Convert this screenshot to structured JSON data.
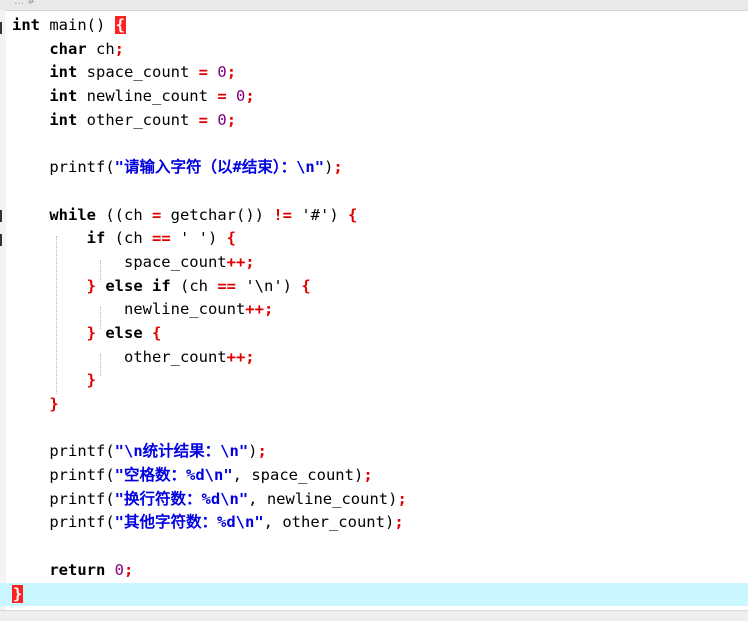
{
  "editor": {
    "tab_hint": "…  #",
    "lines": [
      {
        "segments": [
          {
            "t": "int",
            "c": "kw"
          },
          {
            "t": " main() ",
            "c": ""
          },
          {
            "t": "{",
            "c": "brace-hl"
          }
        ]
      },
      {
        "segments": [
          {
            "t": "    char",
            "c": "kw"
          },
          {
            "t": " ch",
            "c": ""
          },
          {
            "t": ";",
            "c": "op"
          }
        ]
      },
      {
        "segments": [
          {
            "t": "    int",
            "c": "kw"
          },
          {
            "t": " space_count ",
            "c": ""
          },
          {
            "t": "=",
            "c": "op"
          },
          {
            "t": " ",
            "c": ""
          },
          {
            "t": "0",
            "c": "num"
          },
          {
            "t": ";",
            "c": "op"
          }
        ]
      },
      {
        "segments": [
          {
            "t": "    int",
            "c": "kw"
          },
          {
            "t": " newline_count ",
            "c": ""
          },
          {
            "t": "=",
            "c": "op"
          },
          {
            "t": " ",
            "c": ""
          },
          {
            "t": "0",
            "c": "num"
          },
          {
            "t": ";",
            "c": "op"
          }
        ]
      },
      {
        "segments": [
          {
            "t": "    int",
            "c": "kw"
          },
          {
            "t": " other_count ",
            "c": ""
          },
          {
            "t": "=",
            "c": "op"
          },
          {
            "t": " ",
            "c": ""
          },
          {
            "t": "0",
            "c": "num"
          },
          {
            "t": ";",
            "c": "op"
          }
        ]
      },
      {
        "segments": [
          {
            "t": "",
            "c": ""
          }
        ]
      },
      {
        "segments": [
          {
            "t": "    printf(",
            "c": ""
          },
          {
            "t": "\"请输入字符（以#结束）：\\n\"",
            "c": "str"
          },
          {
            "t": ")",
            "c": ""
          },
          {
            "t": ";",
            "c": "op"
          }
        ]
      },
      {
        "segments": [
          {
            "t": "",
            "c": ""
          }
        ]
      },
      {
        "segments": [
          {
            "t": "    while",
            "c": "kw"
          },
          {
            "t": " ((ch ",
            "c": ""
          },
          {
            "t": "=",
            "c": "op"
          },
          {
            "t": " getchar()) ",
            "c": ""
          },
          {
            "t": "!=",
            "c": "op"
          },
          {
            "t": " '#') ",
            "c": ""
          },
          {
            "t": "{",
            "c": "brace"
          }
        ]
      },
      {
        "segments": [
          {
            "t": "        if",
            "c": "kw"
          },
          {
            "t": " (ch ",
            "c": ""
          },
          {
            "t": "==",
            "c": "op"
          },
          {
            "t": " ' ') ",
            "c": ""
          },
          {
            "t": "{",
            "c": "brace"
          }
        ]
      },
      {
        "segments": [
          {
            "t": "            space_count",
            "c": ""
          },
          {
            "t": "++;",
            "c": "op"
          }
        ]
      },
      {
        "segments": [
          {
            "t": "        ",
            "c": ""
          },
          {
            "t": "}",
            "c": "brace"
          },
          {
            "t": " else if",
            "c": "kw"
          },
          {
            "t": " (ch ",
            "c": ""
          },
          {
            "t": "==",
            "c": "op"
          },
          {
            "t": " '\\n') ",
            "c": ""
          },
          {
            "t": "{",
            "c": "brace"
          }
        ]
      },
      {
        "segments": [
          {
            "t": "            newline_count",
            "c": ""
          },
          {
            "t": "++;",
            "c": "op"
          }
        ]
      },
      {
        "segments": [
          {
            "t": "        ",
            "c": ""
          },
          {
            "t": "}",
            "c": "brace"
          },
          {
            "t": " else",
            "c": "kw"
          },
          {
            "t": " ",
            "c": ""
          },
          {
            "t": "{",
            "c": "brace"
          }
        ]
      },
      {
        "segments": [
          {
            "t": "            other_count",
            "c": ""
          },
          {
            "t": "++;",
            "c": "op"
          }
        ]
      },
      {
        "segments": [
          {
            "t": "        ",
            "c": ""
          },
          {
            "t": "}",
            "c": "brace"
          }
        ]
      },
      {
        "segments": [
          {
            "t": "    ",
            "c": ""
          },
          {
            "t": "}",
            "c": "brace"
          }
        ]
      },
      {
        "segments": [
          {
            "t": "",
            "c": ""
          }
        ]
      },
      {
        "segments": [
          {
            "t": "    printf(",
            "c": ""
          },
          {
            "t": "\"\\n统计结果：\\n\"",
            "c": "str"
          },
          {
            "t": ")",
            "c": ""
          },
          {
            "t": ";",
            "c": "op"
          }
        ]
      },
      {
        "segments": [
          {
            "t": "    printf(",
            "c": ""
          },
          {
            "t": "\"空格数：%d\\n\"",
            "c": "str"
          },
          {
            "t": ", space_count)",
            "c": ""
          },
          {
            "t": ";",
            "c": "op"
          }
        ]
      },
      {
        "segments": [
          {
            "t": "    printf(",
            "c": ""
          },
          {
            "t": "\"换行符数：%d\\n\"",
            "c": "str"
          },
          {
            "t": ", newline_count)",
            "c": ""
          },
          {
            "t": ";",
            "c": "op"
          }
        ]
      },
      {
        "segments": [
          {
            "t": "    printf(",
            "c": ""
          },
          {
            "t": "\"其他字符数：%d\\n\"",
            "c": "str"
          },
          {
            "t": ", other_count)",
            "c": ""
          },
          {
            "t": ";",
            "c": "op"
          }
        ]
      },
      {
        "segments": [
          {
            "t": "",
            "c": ""
          }
        ]
      },
      {
        "segments": [
          {
            "t": "    return",
            "c": "kw"
          },
          {
            "t": " ",
            "c": ""
          },
          {
            "t": "0",
            "c": "num"
          },
          {
            "t": ";",
            "c": "op"
          }
        ]
      },
      {
        "segments": [
          {
            "t": "}",
            "c": "brace-hl"
          }
        ],
        "current": true
      }
    ]
  }
}
